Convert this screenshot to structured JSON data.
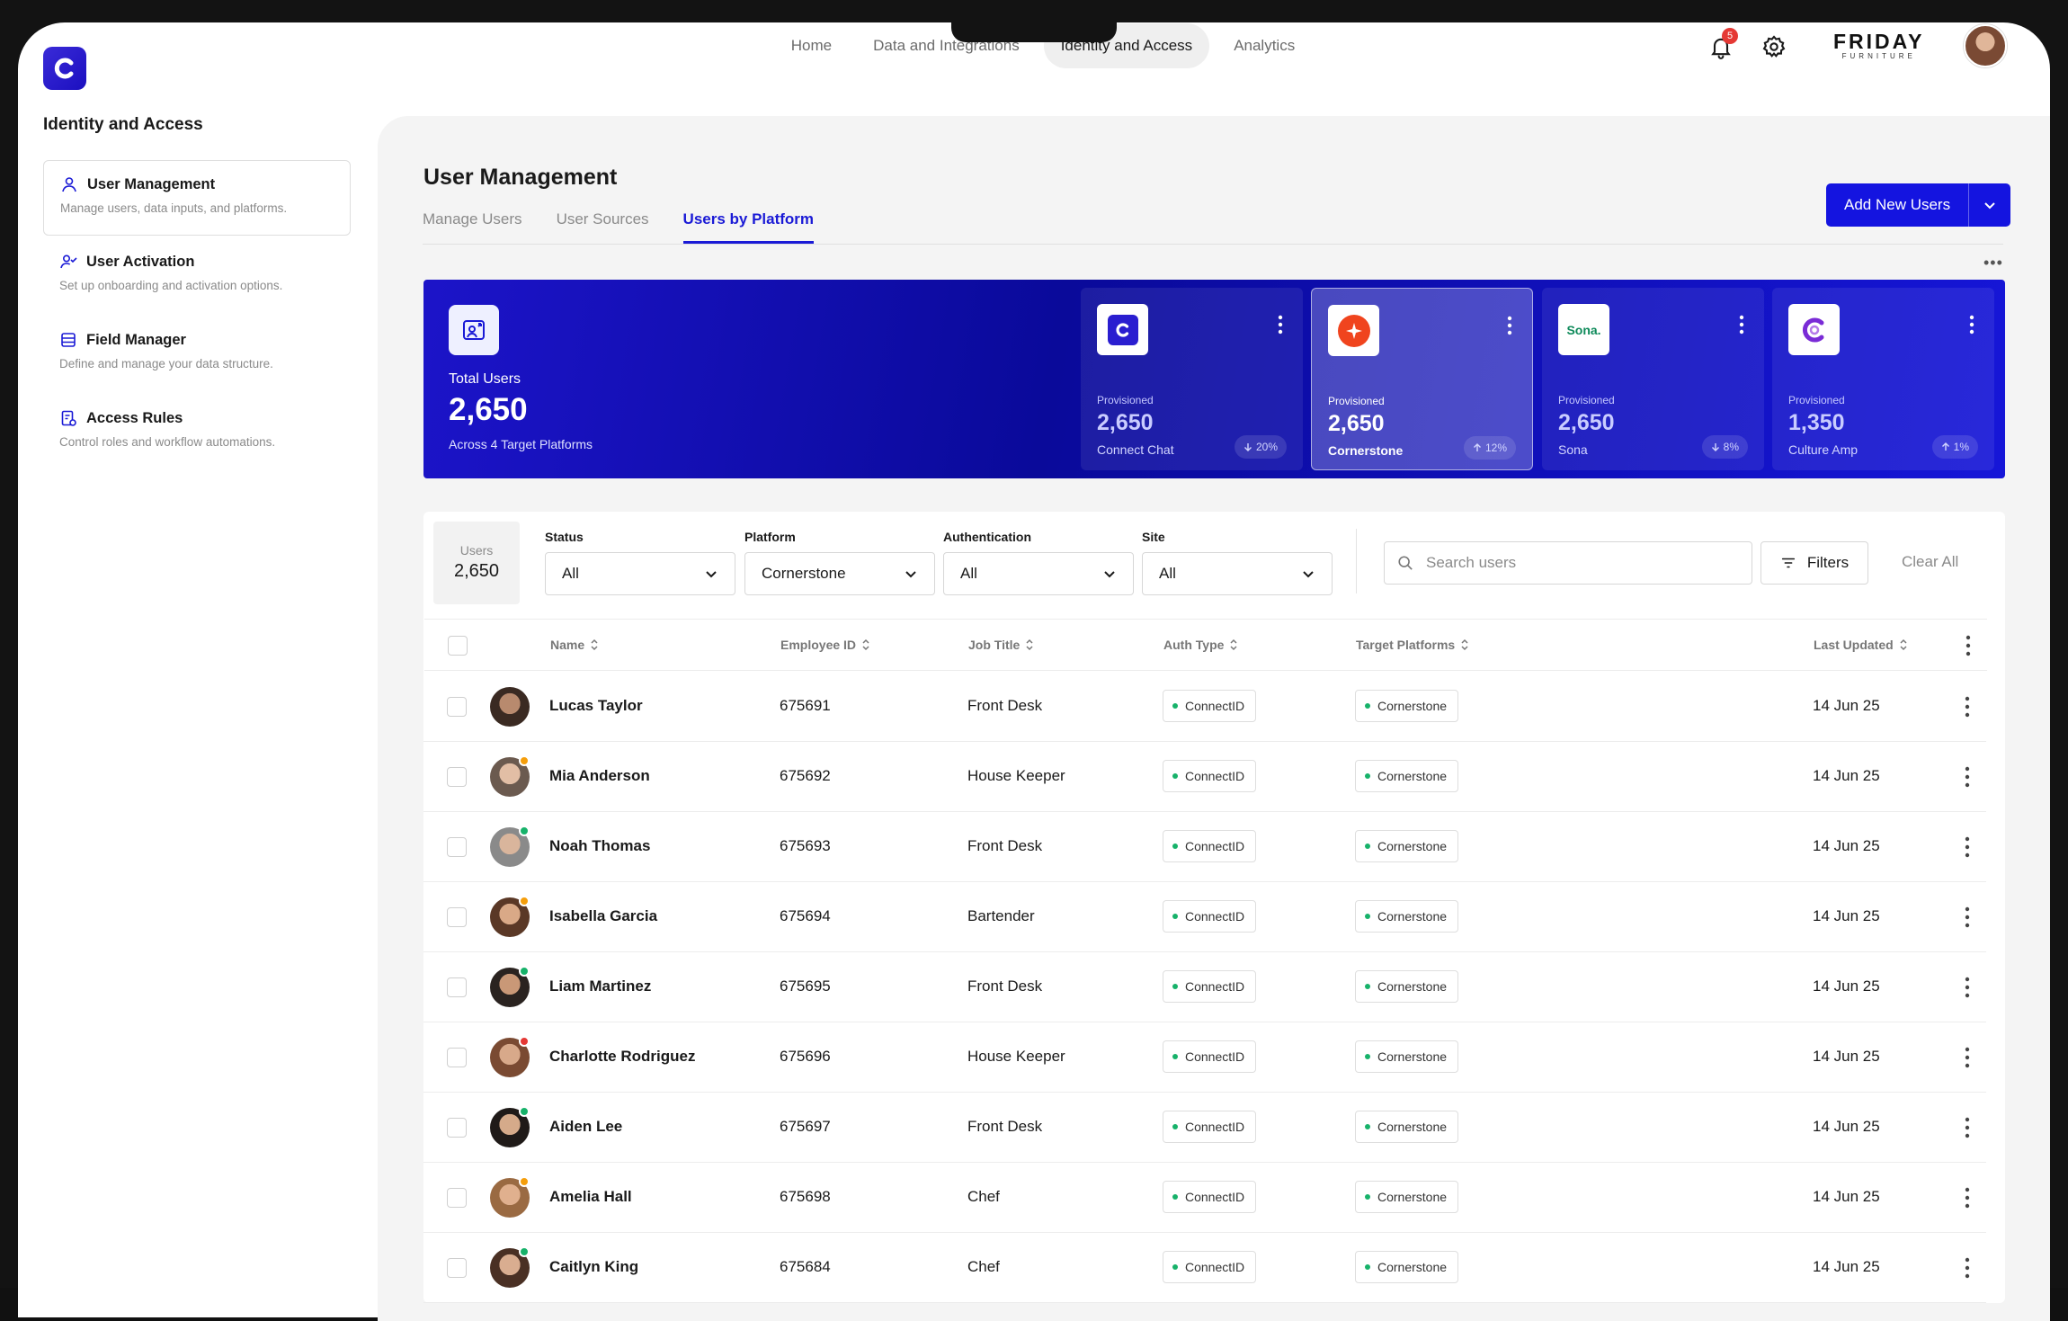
{
  "nav": {
    "items": [
      {
        "label": "Home",
        "active": false
      },
      {
        "label": "Data and Integrations",
        "active": false
      },
      {
        "label": "Identity and Access",
        "active": true
      },
      {
        "label": "Analytics",
        "active": false
      }
    ],
    "notification_count": "5",
    "brand_name": "FRIDAY",
    "brand_sub": "FURNITURE"
  },
  "sidebar": {
    "title": "Identity and Access",
    "items": [
      {
        "label": "User Management",
        "desc": "Manage users, data inputs, and platforms.",
        "icon": "user-icon"
      },
      {
        "label": "User Activation",
        "desc": "Set up onboarding and activation options.",
        "icon": "user-check-icon"
      },
      {
        "label": "Field Manager",
        "desc": "Define and manage your data structure.",
        "icon": "database-icon"
      },
      {
        "label": "Access Rules",
        "desc": "Control roles and workflow automations.",
        "icon": "document-rules-icon"
      }
    ]
  },
  "page": {
    "title": "User Management",
    "tabs": [
      "Manage Users",
      "User Sources",
      "Users by Platform"
    ],
    "active_tab": "Users by Platform",
    "add_button": "Add New Users"
  },
  "hero": {
    "label": "Total Users",
    "total": "2,650",
    "sub": "Across 4 Target Platforms"
  },
  "platforms": [
    {
      "name": "Connect Chat",
      "prov_label": "Provisioned",
      "value": "2,650",
      "delta": "20%",
      "dir": "down",
      "active": false
    },
    {
      "name": "Cornerstone",
      "prov_label": "Provisioned",
      "value": "2,650",
      "delta": "12%",
      "dir": "up",
      "active": true
    },
    {
      "name": "Sona",
      "prov_label": "Provisioned",
      "value": "2,650",
      "delta": "8%",
      "dir": "down",
      "active": false,
      "logo_text": "Sona."
    },
    {
      "name": "Culture Amp",
      "prov_label": "Provisioned",
      "value": "1,350",
      "delta": "1%",
      "dir": "up",
      "active": false
    }
  ],
  "filters": {
    "users_label": "Users",
    "users_count": "2,650",
    "status": {
      "label": "Status",
      "value": "All"
    },
    "platform": {
      "label": "Platform",
      "value": "Cornerstone"
    },
    "authentication": {
      "label": "Authentication",
      "value": "All"
    },
    "site": {
      "label": "Site",
      "value": "All"
    },
    "search_placeholder": "Search users",
    "filters_label": "Filters",
    "clear_label": "Clear All"
  },
  "table": {
    "headers": {
      "name": "Name",
      "employee_id": "Employee ID",
      "job_title": "Job Title",
      "auth_type": "Auth Type",
      "target_platforms": "Target Platforms",
      "last_updated": "Last Updated"
    },
    "rows": [
      {
        "name": "Lucas Taylor",
        "id": "675691",
        "job": "Front Desk",
        "auth": "ConnectID",
        "platform": "Cornerstone",
        "updated": "14 Jun 25",
        "status_color": "",
        "skin": "#b88a6e",
        "hair": "#3a2a22"
      },
      {
        "name": "Mia Anderson",
        "id": "675692",
        "job": "House Keeper",
        "auth": "ConnectID",
        "platform": "Cornerstone",
        "updated": "14 Jun 25",
        "status_color": "#f59e0b",
        "skin": "#e2bea5",
        "hair": "#6b5a4f"
      },
      {
        "name": "Noah Thomas",
        "id": "675693",
        "job": "Front Desk",
        "auth": "ConnectID",
        "platform": "Cornerstone",
        "updated": "14 Jun 25",
        "status_color": "#17b26a",
        "skin": "#d9b59c",
        "hair": "#8a8a8a"
      },
      {
        "name": "Isabella Garcia",
        "id": "675694",
        "job": "Bartender",
        "auth": "ConnectID",
        "platform": "Cornerstone",
        "updated": "14 Jun 25",
        "status_color": "#f59e0b",
        "skin": "#d9a987",
        "hair": "#5a3826"
      },
      {
        "name": "Liam Martinez",
        "id": "675695",
        "job": "Front Desk",
        "auth": "ConnectID",
        "platform": "Cornerstone",
        "updated": "14 Jun 25",
        "status_color": "#17b26a",
        "skin": "#c99877",
        "hair": "#2a2320"
      },
      {
        "name": "Charlotte Rodriguez",
        "id": "675696",
        "job": "House Keeper",
        "auth": "ConnectID",
        "platform": "Cornerstone",
        "updated": "14 Jun 25",
        "status_color": "#e53935",
        "skin": "#d8a98a",
        "hair": "#7a4a32"
      },
      {
        "name": "Aiden Lee",
        "id": "675697",
        "job": "Front Desk",
        "auth": "ConnectID",
        "platform": "Cornerstone",
        "updated": "14 Jun 25",
        "status_color": "#17b26a",
        "skin": "#d5aa8a",
        "hair": "#1f1a18"
      },
      {
        "name": "Amelia Hall",
        "id": "675698",
        "job": "Chef",
        "auth": "ConnectID",
        "platform": "Cornerstone",
        "updated": "14 Jun 25",
        "status_color": "#f59e0b",
        "skin": "#e0b08e",
        "hair": "#9a6a42"
      },
      {
        "name": "Caitlyn King",
        "id": "675684",
        "job": "Chef",
        "auth": "ConnectID",
        "platform": "Cornerstone",
        "updated": "14 Jun 25",
        "status_color": "#17b26a",
        "skin": "#d9ad90",
        "hair": "#4a3024"
      }
    ]
  },
  "colors": {
    "accent": "#1414e0",
    "online": "#17b26a",
    "away": "#f59e0b",
    "busy": "#e53935"
  }
}
